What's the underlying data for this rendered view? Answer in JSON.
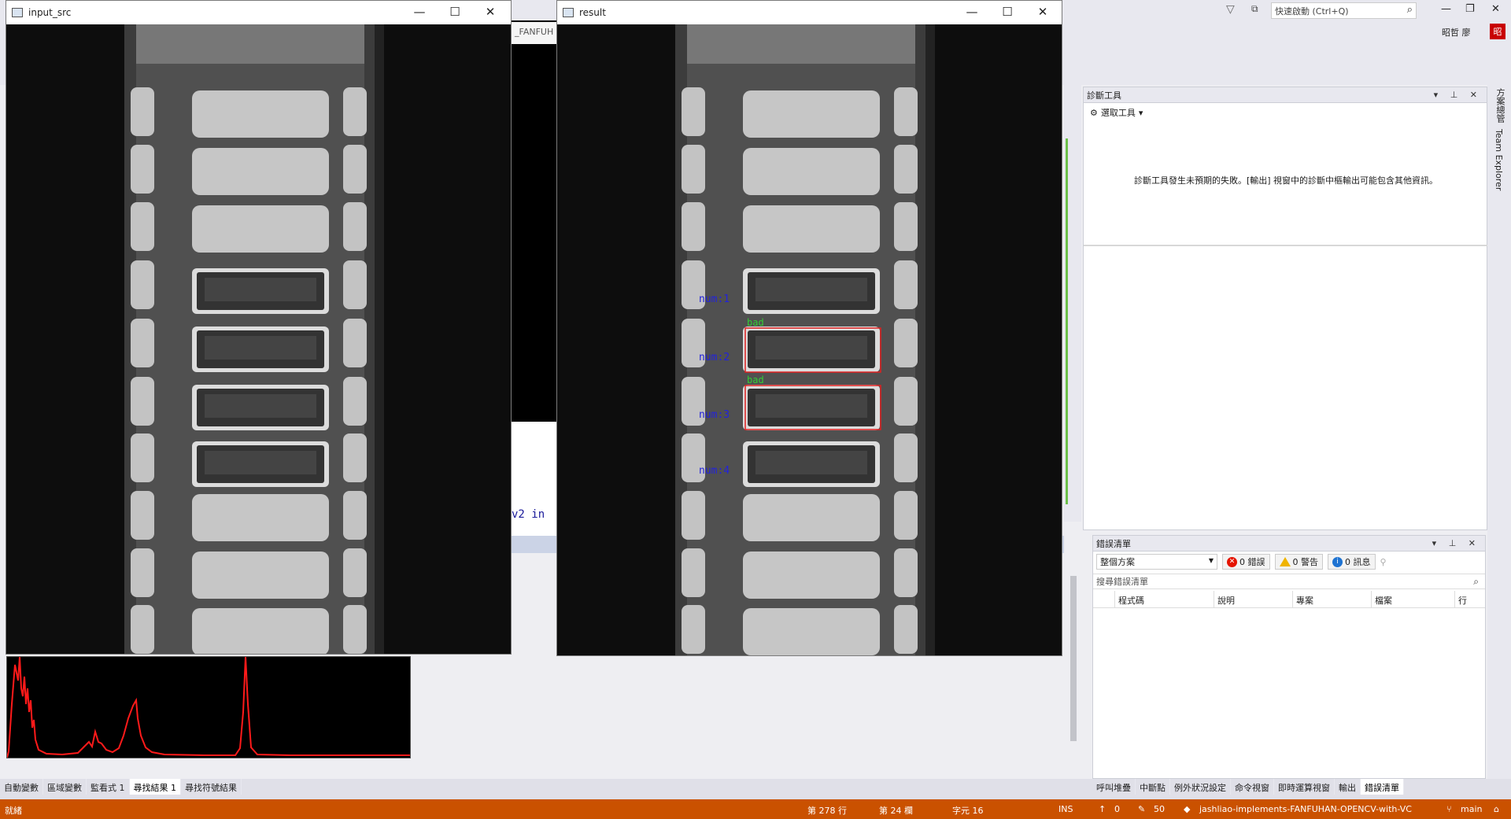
{
  "quick_launch": {
    "placeholder": "快速啟動 (Ctrl+Q)"
  },
  "user": {
    "name": "昭哲 廖",
    "avatar_text": "昭"
  },
  "editor": {
    "tab_label": "_FANFUH",
    "snippet": "v2  in"
  },
  "windows": {
    "input_src": {
      "title": "input_src"
    },
    "result": {
      "title": "result"
    }
  },
  "result_labels": {
    "nums": [
      "num:1",
      "num:2",
      "num:3",
      "num:4"
    ],
    "bad": [
      "bad",
      "bad"
    ]
  },
  "colors": {
    "status_bar": "#ca5100",
    "label_blue": "#2222dd",
    "label_green": "#33cc33",
    "box_red": "#e02020"
  },
  "diagnostics": {
    "title": "診斷工具",
    "select_tool": "選取工具",
    "message": "診斷工具發生未預期的失敗。[輸出] 視窗中的診斷中樞輸出可能包含其他資訊。"
  },
  "side_tabs": [
    "方案總管",
    "Team Explorer"
  ],
  "error_list": {
    "title": "錯誤清單",
    "scope": "整個方案",
    "errors": "0 錯誤",
    "warnings": "0 警告",
    "messages": "0 訊息",
    "search_placeholder": "搜尋錯誤清單",
    "columns": [
      "",
      "程式碼",
      "說明",
      "專案",
      "檔案",
      "行"
    ]
  },
  "bottom_tabs_left": [
    "自動變數",
    "區域變數",
    "監看式 1",
    "尋找結果 1",
    "尋找符號結果"
  ],
  "bottom_tabs_left_active": 3,
  "bottom_tabs_right": [
    "呼叫堆疊",
    "中斷點",
    "例外狀況設定",
    "命令視窗",
    "即時運算視窗",
    "輸出",
    "錯誤清單"
  ],
  "bottom_tabs_right_active": 6,
  "status": {
    "ready": "就緒",
    "line": "第 278 行",
    "col": "第 24 欄",
    "char": "字元 16",
    "ins": "INS",
    "up": "0",
    "edits": "50",
    "repo": "jashliao-implements-FANFUHAN-OPENCV-with-VC",
    "branch": "main"
  }
}
